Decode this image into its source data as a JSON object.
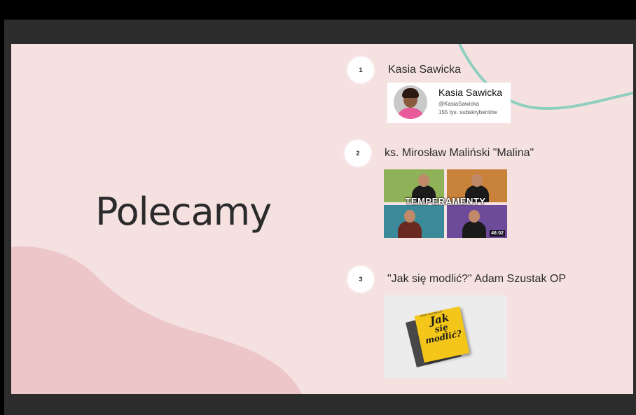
{
  "slide": {
    "title": "Polecamy",
    "background_color": "#f6e1e1",
    "accent_blob_color": "#edc6c9",
    "accent_line_color": "#8fcfbf"
  },
  "items": [
    {
      "number": "1",
      "label": "Kasia Sawicka"
    },
    {
      "number": "2",
      "label": "ks. Mirosław Maliński \"Malina\""
    },
    {
      "number": "3",
      "label": "\"Jak się modlić?\" Adam Szustak OP"
    }
  ],
  "channel_card": {
    "name": "Kasia Sawicka",
    "handle": "@KasiaSawicka",
    "subscribers": "155 tys. subskrybentów"
  },
  "video_thumb": {
    "overlay_text": "TEMPERAMENTY",
    "duration": "46:02",
    "quadrant_colors": [
      "#8fb157",
      "#c9823a",
      "#3a8a99",
      "#6d4a9a"
    ]
  },
  "book": {
    "author": "Adam Szustak OP",
    "title_line1": "Jak",
    "title_line2": "się",
    "title_line3": "modlić?"
  }
}
